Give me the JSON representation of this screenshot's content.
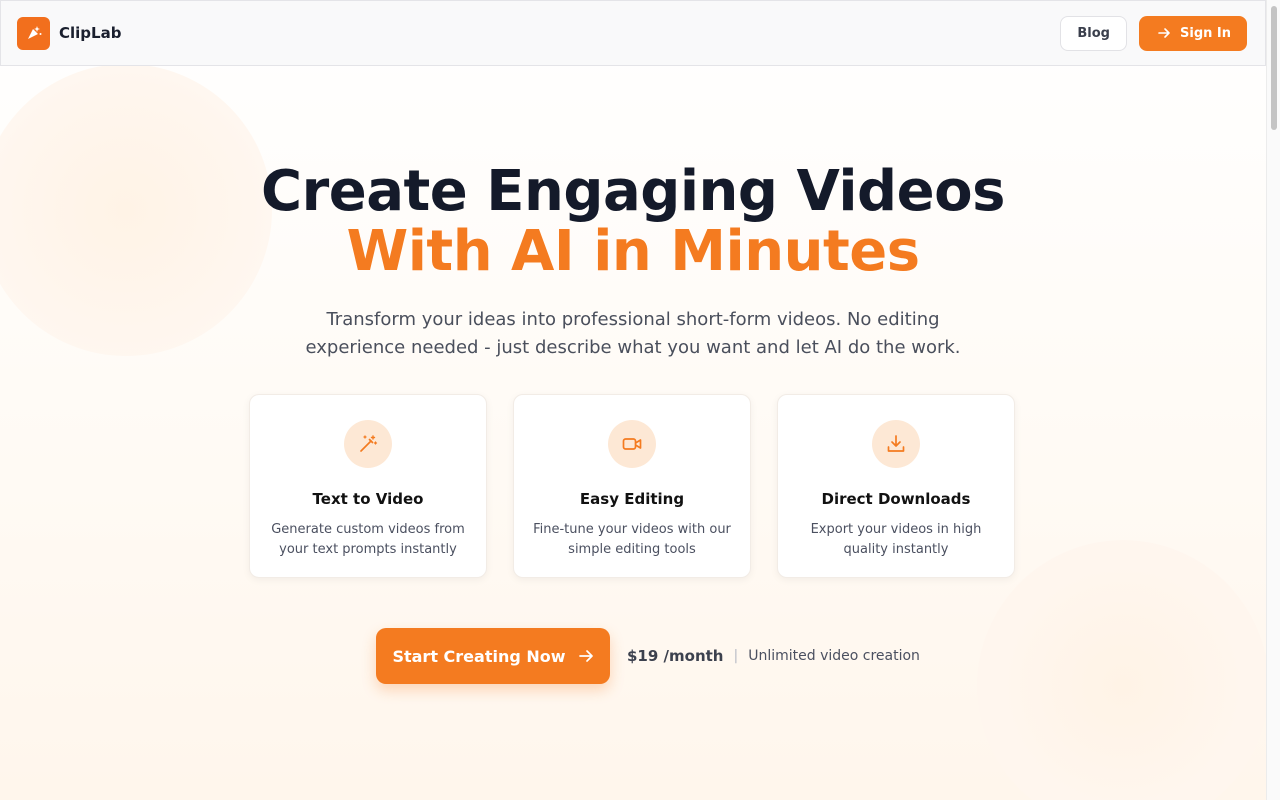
{
  "header": {
    "brand_name": "ClipLab",
    "blog_label": "Blog",
    "signin_label": "Sign In"
  },
  "hero": {
    "title_line1": "Create Engaging Videos",
    "title_line2": "With AI in Minutes",
    "subtitle": "Transform your ideas into professional short-form videos. No editing experience needed - just describe what you want and let AI do the work."
  },
  "features": [
    {
      "icon": "magic-wand-icon",
      "title": "Text to Video",
      "description": "Generate custom videos from your text prompts instantly"
    },
    {
      "icon": "video-camera-icon",
      "title": "Easy Editing",
      "description": "Fine-tune your videos with our simple editing tools"
    },
    {
      "icon": "download-icon",
      "title": "Direct Downloads",
      "description": "Export your videos in high quality instantly"
    }
  ],
  "cta": {
    "button_label": "Start Creating Now",
    "price": "$19 /month",
    "separator": "|",
    "price_note": "Unlimited video creation"
  },
  "colors": {
    "accent": "#f47b20",
    "heading": "#141a2a",
    "icon_bg": "#fde8d5"
  }
}
